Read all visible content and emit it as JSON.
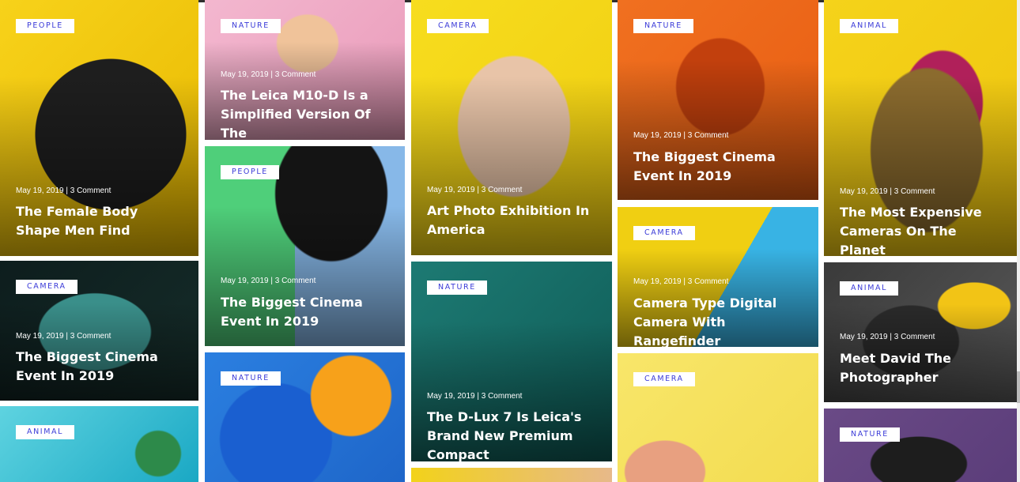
{
  "colors": {
    "tag_text": "#3b3bd8",
    "tag_bg": "#ffffff"
  },
  "cards": [
    {
      "tag": "People",
      "meta": "May 19, 2019 | 3 Comment",
      "title": "The Female Body Shape Men Find",
      "icon": "headphones-photo"
    },
    {
      "tag": "Camera",
      "meta": "May 19, 2019 | 3 Comment",
      "title": "The Biggest Cinema Event In 2019",
      "icon": "iguana-photo"
    },
    {
      "tag": "Animal",
      "meta": "",
      "title": "",
      "icon": "island-aerial-photo"
    },
    {
      "tag": "Nature",
      "meta": "May 19, 2019 | 3 Comment",
      "title": "The Leica M10-D Is a Simplified Version Of The",
      "icon": "macarons-photo"
    },
    {
      "tag": "People",
      "meta": "May 19, 2019 | 3 Comment",
      "title": "The Biggest Cinema Event In 2019",
      "icon": "woman-hat-photo"
    },
    {
      "tag": "Nature",
      "meta": "",
      "title": "",
      "icon": "orange-fruit-photo"
    },
    {
      "tag": "Camera",
      "meta": "May 19, 2019 | 3 Comment",
      "title": "Art Photo Exhibition In America",
      "icon": "painted-hands-photo"
    },
    {
      "tag": "Nature",
      "meta": "May 19, 2019 | 3 Comment",
      "title": "The D-Lux 7 Is Leica's Brand New Premium Compact",
      "icon": "water-villas-photo"
    },
    {
      "tag": "Nature",
      "meta": "May 19, 2019 | 3 Comment",
      "title": "The Biggest Cinema Event In 2019",
      "icon": "megaphone-photo"
    },
    {
      "tag": "Camera",
      "meta": "May 19, 2019 | 3 Comment",
      "title": "Camera Type Digital Camera With Rangefinder",
      "icon": "peace-hand-photo"
    },
    {
      "tag": "Camera",
      "meta": "",
      "title": "",
      "icon": "hand-bottle-photo"
    },
    {
      "tag": "Animal",
      "meta": "May 19, 2019 | 3 Comment",
      "title": "The Most Expensive Cameras On The Planet",
      "icon": "feather-basket-photo"
    },
    {
      "tag": "Animal",
      "meta": "May 19, 2019 | 3 Comment",
      "title": "Meet David The Photographer",
      "icon": "pug-beanie-photo"
    },
    {
      "tag": "Nature",
      "meta": "",
      "title": "",
      "icon": "dark-object-photo"
    }
  ]
}
